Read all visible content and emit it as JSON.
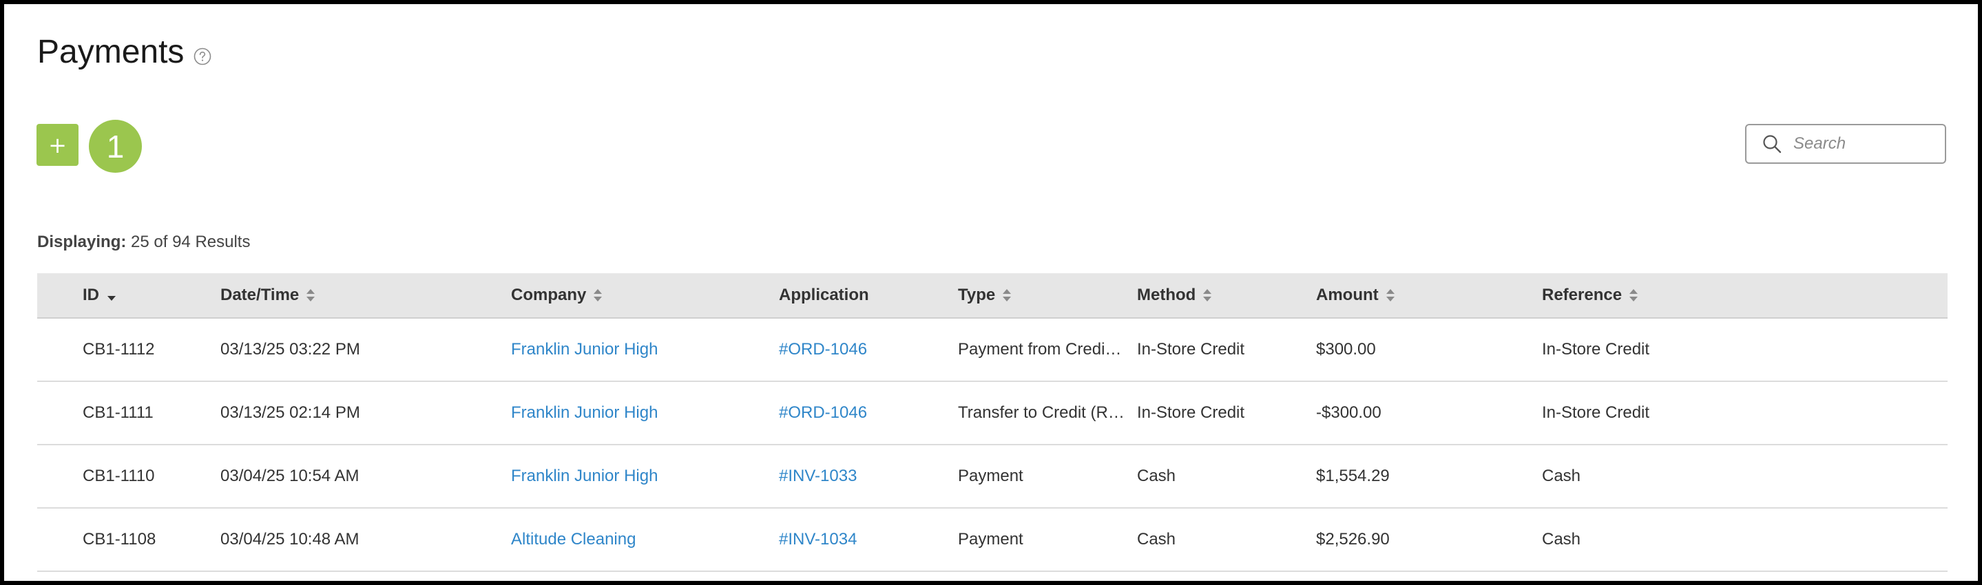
{
  "header": {
    "title": "Payments",
    "help_icon": "question-circle-icon"
  },
  "toolbar": {
    "add_label": "+",
    "badge_count": "1",
    "search_placeholder": "Search",
    "search_value": ""
  },
  "summary": {
    "label": "Displaying:",
    "text": "25 of 94 Results"
  },
  "colors": {
    "accent_green": "#9bc64e",
    "link_blue": "#2f86c9",
    "header_bg": "#e6e6e6"
  },
  "table": {
    "columns": [
      {
        "label": "ID",
        "sort": "desc"
      },
      {
        "label": "Date/Time",
        "sort": "both"
      },
      {
        "label": "Company",
        "sort": "both"
      },
      {
        "label": "Application",
        "sort": "none"
      },
      {
        "label": "Type",
        "sort": "both"
      },
      {
        "label": "Method",
        "sort": "both"
      },
      {
        "label": "Amount",
        "sort": "both"
      },
      {
        "label": "Reference",
        "sort": "both"
      }
    ],
    "rows": [
      {
        "id": "CB1-1112",
        "datetime": "03/13/25 03:22 PM",
        "company": "Franklin Junior High",
        "application": "#ORD-1046",
        "type": "Payment from Credi…",
        "method": "In-Store Credit",
        "amount": "$300.00",
        "reference": "In-Store Credit"
      },
      {
        "id": "CB1-1111",
        "datetime": "03/13/25 02:14 PM",
        "company": "Franklin Junior High",
        "application": "#ORD-1046",
        "type": "Transfer to Credit (R…",
        "method": "In-Store Credit",
        "amount": "-$300.00",
        "reference": "In-Store Credit"
      },
      {
        "id": "CB1-1110",
        "datetime": "03/04/25 10:54 AM",
        "company": "Franklin Junior High",
        "application": "#INV-1033",
        "type": "Payment",
        "method": "Cash",
        "amount": "$1,554.29",
        "reference": "Cash"
      },
      {
        "id": "CB1-1108",
        "datetime": "03/04/25 10:48 AM",
        "company": "Altitude Cleaning",
        "application": "#INV-1034",
        "type": "Payment",
        "method": "Cash",
        "amount": "$2,526.90",
        "reference": "Cash"
      }
    ]
  }
}
